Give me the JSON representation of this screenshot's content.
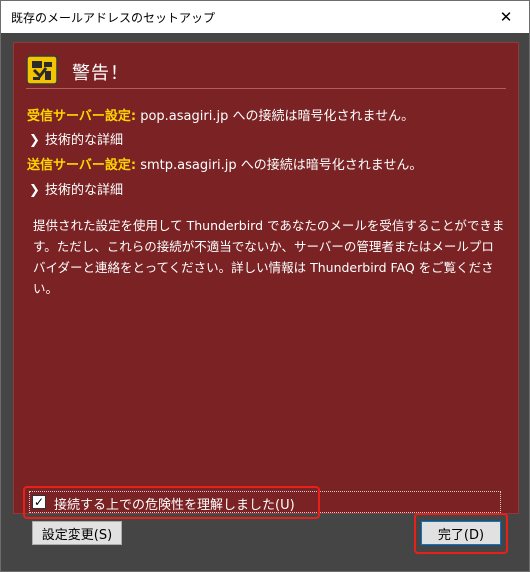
{
  "window": {
    "title": "既存のメールアドレスのセットアップ",
    "close_glyph": "✕"
  },
  "warning": {
    "title": "警告！",
    "icon": "warning-sign-icon"
  },
  "incoming": {
    "label": "受信サーバー設定:",
    "text": "pop.asagiri.jp への接続は暗号化されません。",
    "details_label": "技術的な詳細"
  },
  "outgoing": {
    "label": "送信サーバー設定:",
    "text": "smtp.asagiri.jp への接続は暗号化されません。",
    "details_label": "技術的な詳細"
  },
  "description": "提供された設定を使用して Thunderbird であなたのメールを受信することができます。ただし、これらの接続が不適当でないか、サーバーの管理者またはメールプロバイダーと連絡をとってください。詳しい情報は Thunderbird FAQ をご覧ください。",
  "confirm": {
    "label": "接続する上での危険性を理解しました(U)",
    "checked": true
  },
  "buttons": {
    "change_settings": "設定変更(S)",
    "done": "完了(D)"
  },
  "colors": {
    "panel_bg": "#7a2224",
    "label_yellow": "#ffd400",
    "highlight_red": "#e8201a"
  }
}
